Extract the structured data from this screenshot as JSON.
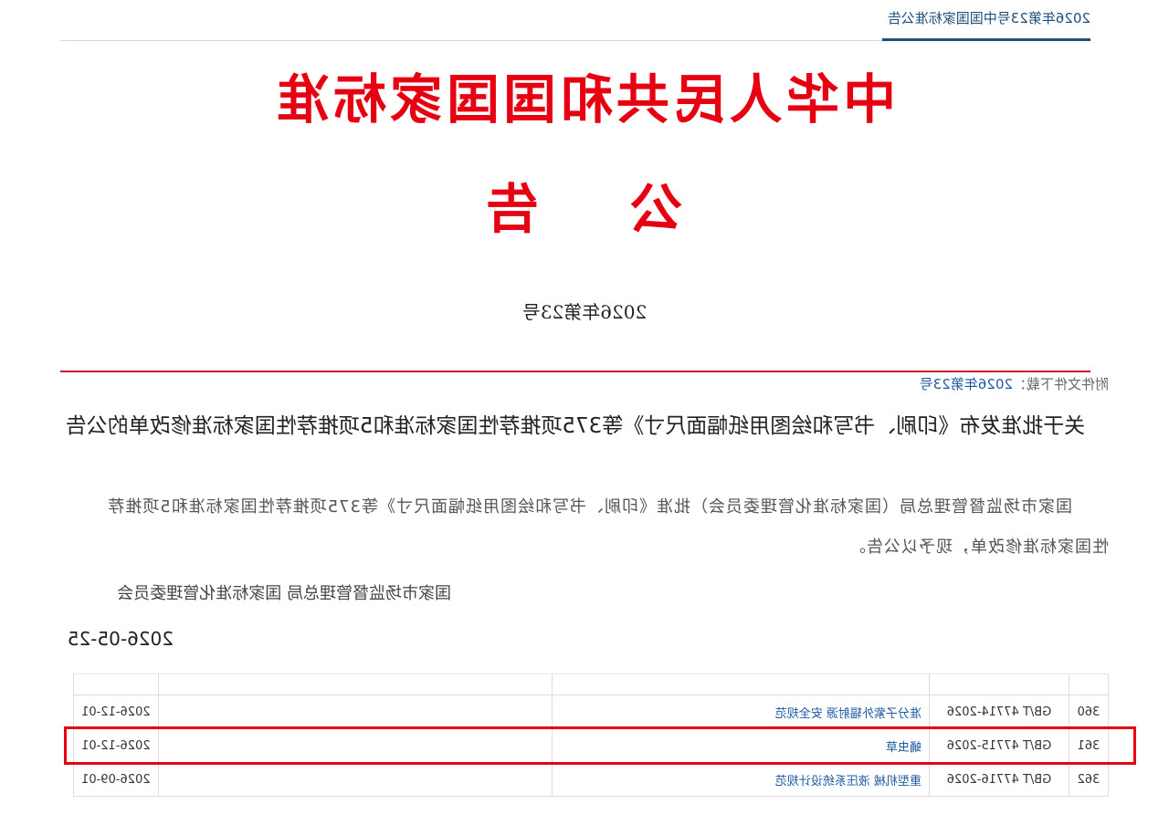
{
  "header": {
    "breadcrumb": "2026年第23号中国国家标准公告"
  },
  "notice": {
    "state_title": "中华人民共和国国家标准",
    "heading": "公告",
    "issue_number": "2026年第23号"
  },
  "attachment": {
    "label": "附件文件下载：",
    "link": "2026年第23号"
  },
  "article": {
    "title": "关于批准发布《印刷、书写和绘图用纸幅面尺寸》等375项推荐性国家标准和5项推荐性国家标准修改单的公告",
    "paragraph": "国家市场监督管理总局（国家标准化管理委员会）批准《印刷、书写和绘图用纸幅面尺寸》等375项推荐性国家标准和5项推荐性国家标准修改单，现予以公告。",
    "signatory": "国家市场监督管理总局 国家标准化管理委员会",
    "date": "2026-05-25"
  },
  "standards_table": {
    "rows": [
      {
        "no": "360",
        "code": "GB/T 47714-2026",
        "name": "准分子紫外辐射源 安全规范",
        "date": "2026-12-01",
        "highlighted": false
      },
      {
        "no": "361",
        "code": "GB/T 47715-2026",
        "name": "蛹虫草",
        "date": "2026-12-01",
        "highlighted": true
      },
      {
        "no": "362",
        "code": "GB/T 47716-2026",
        "name": "重型机械 液压系统设计规范",
        "date": "2026-09-01",
        "highlighted": false
      }
    ]
  }
}
